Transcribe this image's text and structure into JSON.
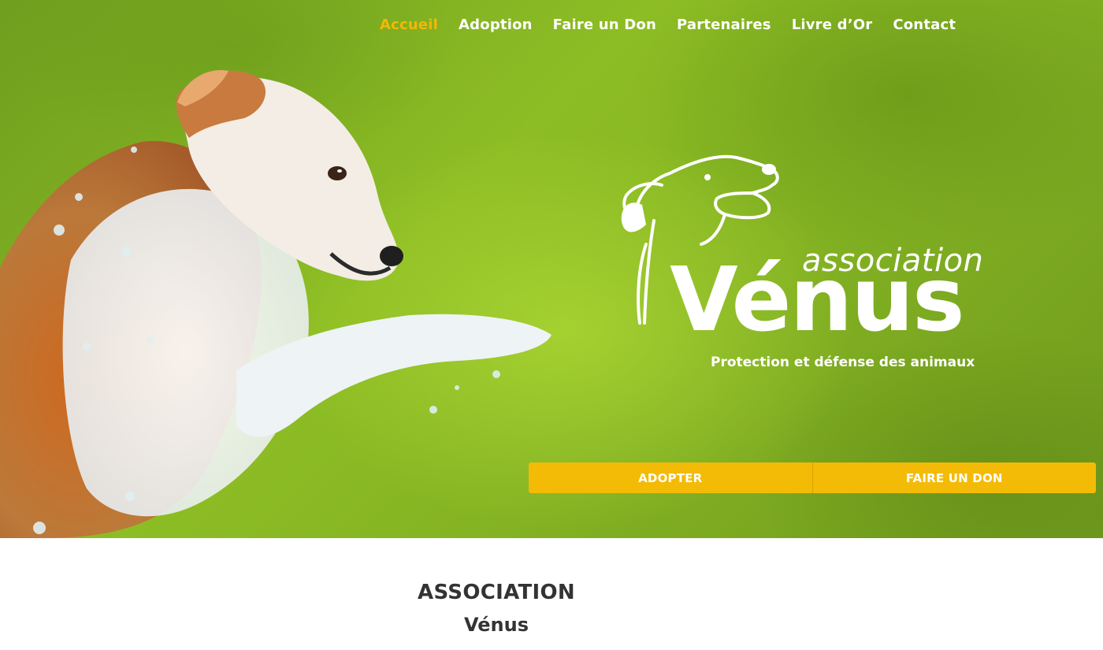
{
  "nav": {
    "items": [
      {
        "label": "Accueil",
        "active": true
      },
      {
        "label": "Adoption",
        "active": false
      },
      {
        "label": "Faire un Don",
        "active": false
      },
      {
        "label": "Partenaires",
        "active": false
      },
      {
        "label": "Livre d’Or",
        "active": false
      },
      {
        "label": "Contact",
        "active": false
      }
    ]
  },
  "logo": {
    "assoc": "association",
    "name": "Vénus",
    "tagline": "Protection et défense des animaux"
  },
  "cta": {
    "adopt_label": "ADOPTER",
    "donate_label": "FAIRE UN DON"
  },
  "section": {
    "title": "ASSOCIATION",
    "subtitle": "Vénus"
  },
  "colors": {
    "accent": "#f3bb06",
    "nav_active": "#f2b806",
    "hero_green": "#8dbd24",
    "text_dark": "#333333"
  }
}
